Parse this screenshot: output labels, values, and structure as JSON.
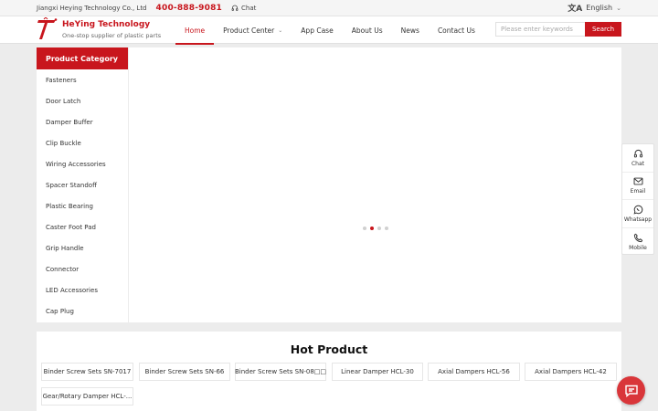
{
  "topbar": {
    "company": "Jiangxi Heying Technology Co., Ltd",
    "phone": "400-888-9081",
    "chat_label": "Chat",
    "language": "English",
    "icons": {
      "chat": "headset-icon",
      "language": "translate-icon",
      "dropdown": "chevron-down-icon"
    }
  },
  "header": {
    "brand_name": "HeYing Technology",
    "tagline": "One-stop supplier of plastic parts",
    "nav": [
      {
        "label": "Home",
        "active": true
      },
      {
        "label": "Product Center",
        "has_dropdown": true
      },
      {
        "label": "App Case"
      },
      {
        "label": "About Us"
      },
      {
        "label": "News"
      },
      {
        "label": "Contact Us"
      }
    ],
    "search": {
      "placeholder": "Please enter keywords",
      "value": "",
      "button_label": "Search"
    }
  },
  "sidebar": {
    "title": "Product Category",
    "categories": [
      "Fasteners",
      "Door Latch",
      "Damper Buffer",
      "Clip Buckle",
      "Wiring Accessories",
      "Spacer Standoff",
      "Plastic Bearing",
      "Caster Foot Pad",
      "Grip Handle",
      "Connector",
      "LED Accessories",
      "Cap Plug"
    ]
  },
  "banner": {
    "slide_count": 4,
    "active_slide": 2
  },
  "hot_product": {
    "title": "Hot Product",
    "items": [
      "Binder Screw Sets SN-7017",
      "Binder Screw Sets SN-66",
      "Binder Screw Sets SN-08□□",
      "Linear Damper HCL-30",
      "Axial Dampers HCL-56",
      "Axial Dampers HCL-42",
      "Gear/Rotary Damper HCL-..."
    ]
  },
  "float_bar": [
    {
      "label": "Chat",
      "icon": "headset-icon"
    },
    {
      "label": "Email",
      "icon": "mail-icon"
    },
    {
      "label": "Whatsapp",
      "icon": "whatsapp-icon"
    },
    {
      "label": "Mobile",
      "icon": "phone-icon"
    }
  ],
  "chat_fab": {
    "icon": "message-icon"
  },
  "colors": {
    "brand": "#c8161d",
    "page_bg": "#ececec",
    "fab": "#d9363a"
  }
}
